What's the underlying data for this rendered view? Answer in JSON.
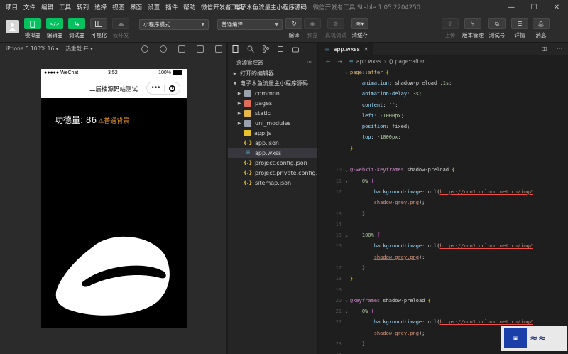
{
  "menu": [
    "项目",
    "文件",
    "编辑",
    "工具",
    "转到",
    "选择",
    "视图",
    "界面",
    "设置",
    "插件",
    "帮助",
    "微信开发者工具"
  ],
  "window": {
    "title": "电子木鱼流量主小程序源码",
    "app_version": "微信开发者工具 Stable 1.05.2204250",
    "minimize": "—",
    "maximize": "☐",
    "close": "✕"
  },
  "toolbar": {
    "simulator": "模拟器",
    "editor": "编辑器",
    "debugger": "调试器",
    "visualize": "可视化",
    "cloud": "云开发",
    "mode_select": "小程序模式",
    "compile_select": "普通编译",
    "compile": "编译",
    "preview": "预览",
    "remote_debug": "真机调试",
    "clear_cache": "清缓存",
    "upload": "上传",
    "version_mgmt": "版本管理",
    "test_account": "测试号",
    "details": "详情",
    "messages": "消息",
    "accent_color": "#07c160"
  },
  "simulator": {
    "device": "iPhone 5 100% 16 ▾",
    "hot_reload": "热重载 开 ▾",
    "status_left": "●●●●● WeChat",
    "status_time": "3:52",
    "status_battery": "100%",
    "nav_title": "二层楼源码站测试",
    "capsule_dots": "•••",
    "merit_text": "功德量: 86",
    "merit_badge": "⚠普通背景",
    "badge_color": "#f7a030"
  },
  "tree": {
    "header": "资源管理器",
    "open_editors": "打开的编辑器",
    "project": "电子木鱼流量主小程序源码",
    "items": [
      {
        "label": "common",
        "kind": "folder"
      },
      {
        "label": "pages",
        "kind": "folder-red"
      },
      {
        "label": "static",
        "kind": "folder-yel"
      },
      {
        "label": "uni_modules",
        "kind": "folder"
      },
      {
        "label": "app.js",
        "kind": "js"
      },
      {
        "label": "app.json",
        "kind": "json"
      },
      {
        "label": "app.wxss",
        "kind": "css",
        "selected": true
      },
      {
        "label": "project.config.json",
        "kind": "json"
      },
      {
        "label": "project.private.config.js...",
        "kind": "json"
      },
      {
        "label": "sitemap.json",
        "kind": "json"
      }
    ]
  },
  "editor": {
    "tab_label": "app.wxss",
    "breadcrumb_file": "app.wxss",
    "breadcrumb_symbol": "page::after",
    "lines": [
      {
        "n": "",
        "fold": "⌄",
        "html": "<span class='c-sel'>page::after</span> <span class='c-br'>{</span>"
      },
      {
        "n": "",
        "fold": "",
        "html": "    <span class='c-prop'>animation</span><span class='c-p'>: shadow-preload </span><span class='c-num'>.1s</span><span class='c-p'>;</span>"
      },
      {
        "n": "",
        "fold": "",
        "html": "    <span class='c-prop'>animation-delay</span><span class='c-p'>: </span><span class='c-num'>3s</span><span class='c-p'>;</span>"
      },
      {
        "n": "",
        "fold": "",
        "html": "    <span class='c-prop'>content</span><span class='c-p'>: </span><span class='c-val'>\"\"</span><span class='c-p'>;</span>"
      },
      {
        "n": "",
        "fold": "",
        "html": "    <span class='c-prop'>left</span><span class='c-p'>: </span><span class='c-num'>-1000px</span><span class='c-p'>;</span>"
      },
      {
        "n": "",
        "fold": "",
        "html": "    <span class='c-prop'>position</span><span class='c-p'>: fixed;</span>"
      },
      {
        "n": "",
        "fold": "",
        "html": "    <span class='c-prop'>top</span><span class='c-p'>: </span><span class='c-num'>-1000px</span><span class='c-p'>;</span>"
      },
      {
        "n": "",
        "fold": "",
        "html": "<span class='c-br'>}</span>"
      },
      {
        "n": "",
        "fold": "",
        "html": ""
      },
      {
        "n": "10",
        "fold": "⌄",
        "html": "<span class='c-at'>@-webkit-keyframes</span><span class='c-p'> shadow-preload </span><span class='c-br'>{</span>"
      },
      {
        "n": "11",
        "fold": "⌄",
        "html": "    <span class='c-num'>0%</span> <span class='c-br2'>{</span>"
      },
      {
        "n": "12",
        "fold": "",
        "html": "        <span class='c-prop'>background-image</span><span class='c-p'>: url(</span><span class='c-url'>https://cdn1.dcloud.net.cn/img/</span>"
      },
      {
        "n": "",
        "fold": "",
        "html": "        <span class='c-url'>shadow-grey.png</span><span class='c-p'>);</span>"
      },
      {
        "n": "13",
        "fold": "",
        "html": "    <span class='c-br2'>}</span>"
      },
      {
        "n": "14",
        "fold": "",
        "html": ""
      },
      {
        "n": "15",
        "fold": "⌄",
        "html": "    <span class='c-num'>100%</span> <span class='c-br2'>{</span>"
      },
      {
        "n": "16",
        "fold": "",
        "html": "        <span class='c-prop'>background-image</span><span class='c-p'>: url(</span><span class='c-url'>https://cdn1.dcloud.net.cn/img/</span>"
      },
      {
        "n": "",
        "fold": "",
        "html": "        <span class='c-url'>shadow-grey.png</span><span class='c-p'>);</span>"
      },
      {
        "n": "17",
        "fold": "",
        "html": "    <span class='c-br2'>}</span>"
      },
      {
        "n": "18",
        "fold": "",
        "html": "<span class='c-br'>}</span>"
      },
      {
        "n": "19",
        "fold": "",
        "html": ""
      },
      {
        "n": "20",
        "fold": "⌄",
        "html": "<span class='c-at'>@keyframes</span><span class='c-p'> shadow-preload </span><span class='c-br'>{</span>"
      },
      {
        "n": "21",
        "fold": "⌄",
        "html": "    <span class='c-num'>0%</span> <span class='c-br2'>{</span>"
      },
      {
        "n": "22",
        "fold": "",
        "html": "        <span class='c-prop'>background-image</span><span class='c-p'>: url(</span><span class='c-url'>https://cdn1.dcloud.net.cn/img/</span>"
      },
      {
        "n": "",
        "fold": "",
        "html": "        <span class='c-url'>shadow-grey.png</span><span class='c-p'>);</span>"
      },
      {
        "n": "23",
        "fold": "",
        "html": "    <span class='c-br2'>}</span>"
      },
      {
        "n": "24",
        "fold": "",
        "html": ""
      }
    ]
  }
}
